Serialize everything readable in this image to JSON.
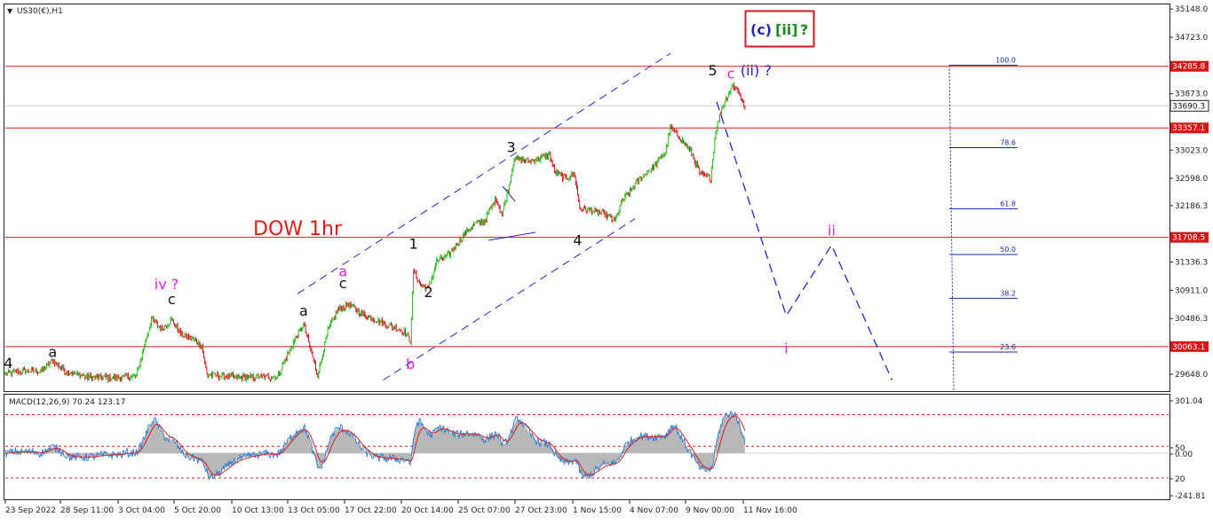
{
  "symbol": "US30(€),H1",
  "title": "DOW 1hr",
  "macd_label": "MACD(12,26,9) 70.24 123.17",
  "scenario_box": {
    "open": "(c)",
    "wave": "[ii]",
    "q": "?"
  },
  "colors": {
    "bull": "#2bb81b",
    "bear": "#d0141b",
    "level": "#d41a1a",
    "fib": "#1a2a9c",
    "pink": "#e020e0",
    "blue": "#2424c8",
    "green": "#1e8c1e",
    "macd_hist": "#b8b8b8",
    "macd_line": "#3a7fd0",
    "signal": "#d42020",
    "price_tag": "#d81616"
  },
  "chart_data": {
    "type": "candlestick",
    "price_axis": {
      "ticks": [
        "35148.0",
        "34723.0",
        "34285.8",
        "33873.0",
        "33690.3",
        "33357.1",
        "33023.0",
        "32598.0",
        "32186.3",
        "31708.5",
        "31336.3",
        "30911.0",
        "30486.3",
        "30063.1",
        "29648.0"
      ],
      "range": [
        29560,
        35220
      ]
    },
    "time_axis": [
      "23 Sep 2022",
      "28 Sep 11:00",
      "3 Oct 04:00",
      "5 Oct 20:00",
      "10 Oct 13:00",
      "13 Oct 05:00",
      "17 Oct 22:00",
      "20 Oct 14:00",
      "25 Oct 07:00",
      "27 Oct 23:00",
      "1 Nov 15:00",
      "4 Nov 07:00",
      "9 Nov 00:00",
      "11 Nov 16:00"
    ],
    "levels": [
      {
        "value": 34285.8,
        "label": "34285.8"
      },
      {
        "value": 33357.1,
        "label": "33357.1"
      },
      {
        "value": 31708.5,
        "label": "31708.5"
      },
      {
        "value": 30063.1,
        "label": "30063.1"
      }
    ],
    "current_price": {
      "value": 33690.3,
      "label": "33690.3"
    },
    "fib_levels": [
      {
        "ratio_label": "100.0",
        "value": 34300
      },
      {
        "ratio_label": "78.6",
        "value": 33060
      },
      {
        "ratio_label": "61.8",
        "value": 32140
      },
      {
        "ratio_label": "50.0",
        "value": 31450
      },
      {
        "ratio_label": "38.2",
        "value": 30790
      },
      {
        "ratio_label": "23.6",
        "value": 29980
      }
    ],
    "wave_labels": [
      {
        "text": "4",
        "color": "black",
        "bar": 3,
        "value": 29740
      },
      {
        "text": "a",
        "color": "black",
        "bar": 47,
        "value": 29910
      },
      {
        "text": "iv ?",
        "color": "pink",
        "bar": 160,
        "value": 30930
      },
      {
        "text": "c",
        "color": "black",
        "bar": 165,
        "value": 30700
      },
      {
        "text": "a",
        "color": "black",
        "bar": 296,
        "value": 30530
      },
      {
        "text": "a",
        "color": "pink",
        "bar": 335,
        "value": 31120
      },
      {
        "text": "c",
        "color": "black",
        "bar": 335,
        "value": 30940
      },
      {
        "text": "b",
        "color": "pink",
        "bar": 402,
        "value": 29730
      },
      {
        "text": "1",
        "color": "black",
        "bar": 405,
        "value": 31540
      },
      {
        "text": "2",
        "color": "black",
        "bar": 420,
        "value": 30810
      },
      {
        "text": "3",
        "color": "black",
        "bar": 502,
        "value": 32990
      },
      {
        "text": "4",
        "color": "black",
        "bar": 568,
        "value": 31590
      },
      {
        "text": "5",
        "color": "black",
        "bar": 702,
        "value": 34150
      },
      {
        "text": "c",
        "color": "pink",
        "bar": 720,
        "value": 34100
      },
      {
        "text": "(ii) ?",
        "color": "blue",
        "bar": 745,
        "value": 34150
      },
      {
        "text": "i",
        "color": "pink",
        "bar": 775,
        "value": 29960
      },
      {
        "text": "ii",
        "color": "pink",
        "bar": 820,
        "value": 31740
      }
    ],
    "forecast_path": [
      {
        "bar": 706,
        "value": 33750
      },
      {
        "bar": 775,
        "value": 30530
      },
      {
        "bar": 820,
        "value": 31590
      },
      {
        "bar": 880,
        "value": 29560
      }
    ],
    "channel": {
      "upper": [
        {
          "bar": 290,
          "value": 30860
        },
        {
          "bar": 660,
          "value": 34480
        }
      ],
      "lower": [
        {
          "bar": 375,
          "value": 29560
        },
        {
          "bar": 625,
          "value": 31990
        }
      ]
    },
    "macd": {
      "label": "MACD(12,26,9)",
      "macd_value": 70.24,
      "signal_value": 123.17,
      "ticks": [
        "301.04",
        "50",
        "0.00",
        "20",
        "-241.81"
      ],
      "levels": [
        280,
        50,
        -180
      ]
    },
    "waypoints": [
      [
        0,
        29640
      ],
      [
        10,
        29680
      ],
      [
        20,
        29700
      ],
      [
        35,
        29690
      ],
      [
        47,
        29850
      ],
      [
        60,
        29690
      ],
      [
        80,
        29610
      ],
      [
        110,
        29590
      ],
      [
        130,
        29620
      ],
      [
        140,
        30200
      ],
      [
        145,
        30480
      ],
      [
        155,
        30320
      ],
      [
        165,
        30470
      ],
      [
        175,
        30240
      ],
      [
        185,
        30190
      ],
      [
        195,
        30080
      ],
      [
        200,
        29640
      ],
      [
        230,
        29600
      ],
      [
        270,
        29610
      ],
      [
        285,
        30100
      ],
      [
        296,
        30400
      ],
      [
        305,
        29900
      ],
      [
        310,
        29640
      ],
      [
        320,
        30300
      ],
      [
        330,
        30620
      ],
      [
        340,
        30700
      ],
      [
        355,
        30550
      ],
      [
        370,
        30450
      ],
      [
        395,
        30300
      ],
      [
        402,
        30150
      ],
      [
        405,
        31200
      ],
      [
        412,
        31000
      ],
      [
        420,
        30940
      ],
      [
        428,
        31350
      ],
      [
        440,
        31440
      ],
      [
        455,
        31750
      ],
      [
        465,
        31900
      ],
      [
        475,
        31950
      ],
      [
        487,
        32300
      ],
      [
        493,
        32050
      ],
      [
        500,
        32500
      ],
      [
        505,
        32900
      ],
      [
        520,
        32850
      ],
      [
        540,
        32950
      ],
      [
        545,
        32700
      ],
      [
        555,
        32600
      ],
      [
        565,
        32650
      ],
      [
        570,
        32150
      ],
      [
        585,
        32100
      ],
      [
        595,
        32050
      ],
      [
        605,
        31950
      ],
      [
        612,
        32250
      ],
      [
        620,
        32400
      ],
      [
        630,
        32600
      ],
      [
        645,
        32800
      ],
      [
        655,
        33000
      ],
      [
        660,
        33350
      ],
      [
        670,
        33200
      ],
      [
        680,
        33000
      ],
      [
        690,
        32650
      ],
      [
        700,
        32600
      ],
      [
        705,
        33320
      ],
      [
        712,
        33700
      ],
      [
        722,
        34000
      ],
      [
        728,
        33900
      ],
      [
        734,
        33650
      ]
    ],
    "n_bars": 735
  }
}
